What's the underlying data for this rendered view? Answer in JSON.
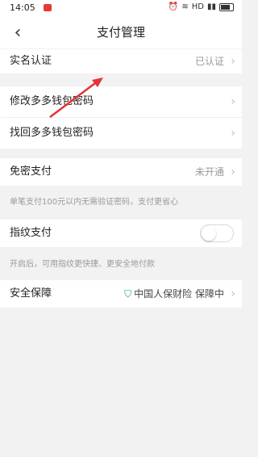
{
  "status_bar": {
    "time": "14:05",
    "network": "HD",
    "battery_icon": "battery-icon"
  },
  "header": {
    "title": "支付管理"
  },
  "rows": {
    "real_name": {
      "label": "实名认证",
      "value": "已认证"
    },
    "change_pwd": {
      "label": "修改多多钱包密码"
    },
    "find_pwd": {
      "label": "找回多多钱包密码"
    },
    "free_pay": {
      "label": "免密支付",
      "value": "未开通"
    },
    "fingerprint": {
      "label": "指纹支付",
      "enabled": false
    },
    "security": {
      "label": "安全保障",
      "insurer": "中国人保财险",
      "status": "保障中"
    }
  },
  "notes": {
    "free_pay": "单笔支付100元以内无需验证密码，支付更省心",
    "fingerprint": "开启后，可用指纹更快捷、更安全地付款"
  },
  "colors": {
    "accent_green": "#1aa64a",
    "arrow_red": "#e5323b"
  }
}
